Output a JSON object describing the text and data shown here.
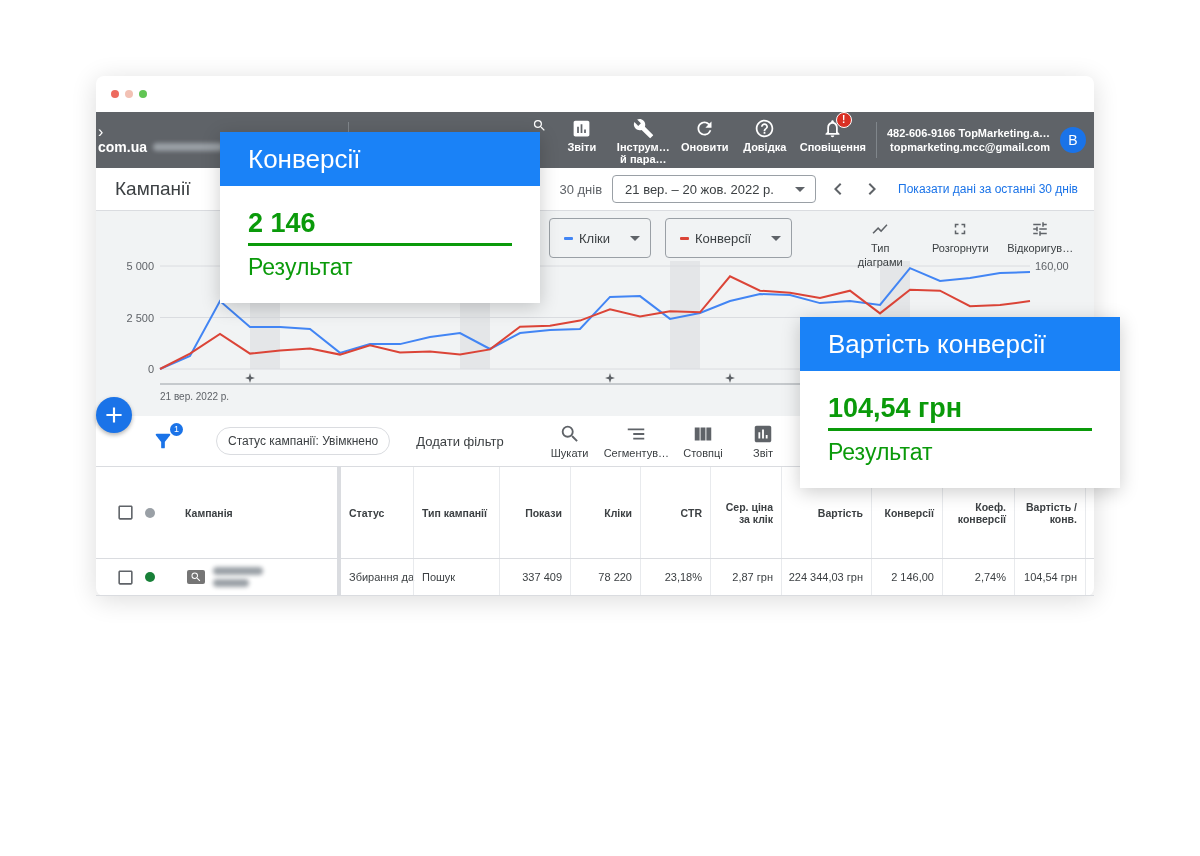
{
  "top_bar": {
    "back": "›",
    "domain": "com.ua",
    "tools": [
      {
        "kind": "search"
      },
      {
        "kind": "reports",
        "lines": [
          "Звіти"
        ]
      },
      {
        "kind": "tools",
        "lines": [
          "Інструм…",
          "й пара…"
        ]
      },
      {
        "kind": "refresh",
        "lines": [
          "Оновити"
        ]
      },
      {
        "kind": "help",
        "lines": [
          "Довідка"
        ]
      },
      {
        "kind": "bell",
        "lines": [
          "Сповіщення"
        ],
        "badge": "!"
      }
    ],
    "account": {
      "line1": "482-606-9166 TopMarketing.a…",
      "line2": "topmarketing.mcc@gmail.com",
      "avatar": "B"
    }
  },
  "sub_bar": {
    "title": "Кампанії",
    "range_label": "30 днів",
    "date_range": "21 вер. – 20 жов. 2022 р.",
    "link": "Показати дані за останні 30 днів"
  },
  "chart_panel": {
    "tools": [
      {
        "kind": "chart-type",
        "lines": [
          "Тип",
          "діаграми"
        ]
      },
      {
        "kind": "expand",
        "lines": [
          "Розгорнути"
        ]
      },
      {
        "kind": "adjust",
        "lines": [
          "Відкоригув…"
        ]
      }
    ],
    "chart_data": {
      "type": "line",
      "ylim": [
        0,
        5000
      ],
      "yticks": [
        {
          "value": 0,
          "label": "0"
        },
        {
          "value": 2500,
          "label": "2 500"
        },
        {
          "value": 5000,
          "label": "5 000"
        }
      ],
      "annotations": [
        "21 вер. 2022 р.",
        "160,00"
      ],
      "series": [
        {
          "name": "Кліки",
          "color": "#4285f4",
          "values": [
            0,
            630,
            3300,
            2040,
            2040,
            1940,
            780,
            1210,
            1210,
            1550,
            1750,
            970,
            1750,
            1890,
            1940,
            3500,
            3540,
            2430,
            2720,
            3300,
            3640,
            3590,
            3200,
            3300,
            3110,
            4900,
            4270,
            4420,
            4660,
            4710
          ]
        },
        {
          "name": "Конверсії",
          "color": "#db4437",
          "values": [
            0,
            750,
            1700,
            750,
            900,
            1000,
            700,
            1150,
            800,
            850,
            700,
            950,
            2050,
            2100,
            2350,
            2900,
            2550,
            2800,
            2750,
            4500,
            3800,
            3700,
            3450,
            3800,
            2700,
            3850,
            3800,
            3050,
            3100,
            3300
          ]
        }
      ]
    }
  },
  "filter_bar": {
    "filter_count": "1",
    "chip": "Статус кампанії: Увімкнено",
    "add_filter": "Додати фільтр",
    "tools": [
      {
        "kind": "search",
        "label": "Шукати"
      },
      {
        "kind": "segment",
        "label": "Сегментув…"
      },
      {
        "kind": "columns",
        "label": "Стовпці"
      },
      {
        "kind": "reports",
        "label": "Звіт"
      }
    ]
  },
  "table": {
    "header_checked": false,
    "columns": [
      "Кампанія",
      "Статус",
      "Тип кампанії",
      "Покази",
      "Кліки",
      "CTR",
      "Сер. ціна за клік",
      "Вартість",
      "Конверсії",
      "Коеф. конверсії",
      "Вартість / конв."
    ],
    "rows": [
      {
        "checked": false,
        "color": "#188038",
        "cells": [
          "",
          "Збирання да",
          "Пошук",
          "337 409",
          "78 220",
          "23,18%",
          "2,87 грн",
          "224 344,03 грн",
          "2 146,00",
          "2,74%",
          "104,54 грн"
        ]
      }
    ]
  },
  "callouts": [
    {
      "title": "Конверсії",
      "value": "2 146",
      "caption": "Результат"
    },
    {
      "title": "Вартість конверсії",
      "value": "104,54 грн",
      "caption": "Результат"
    }
  ]
}
